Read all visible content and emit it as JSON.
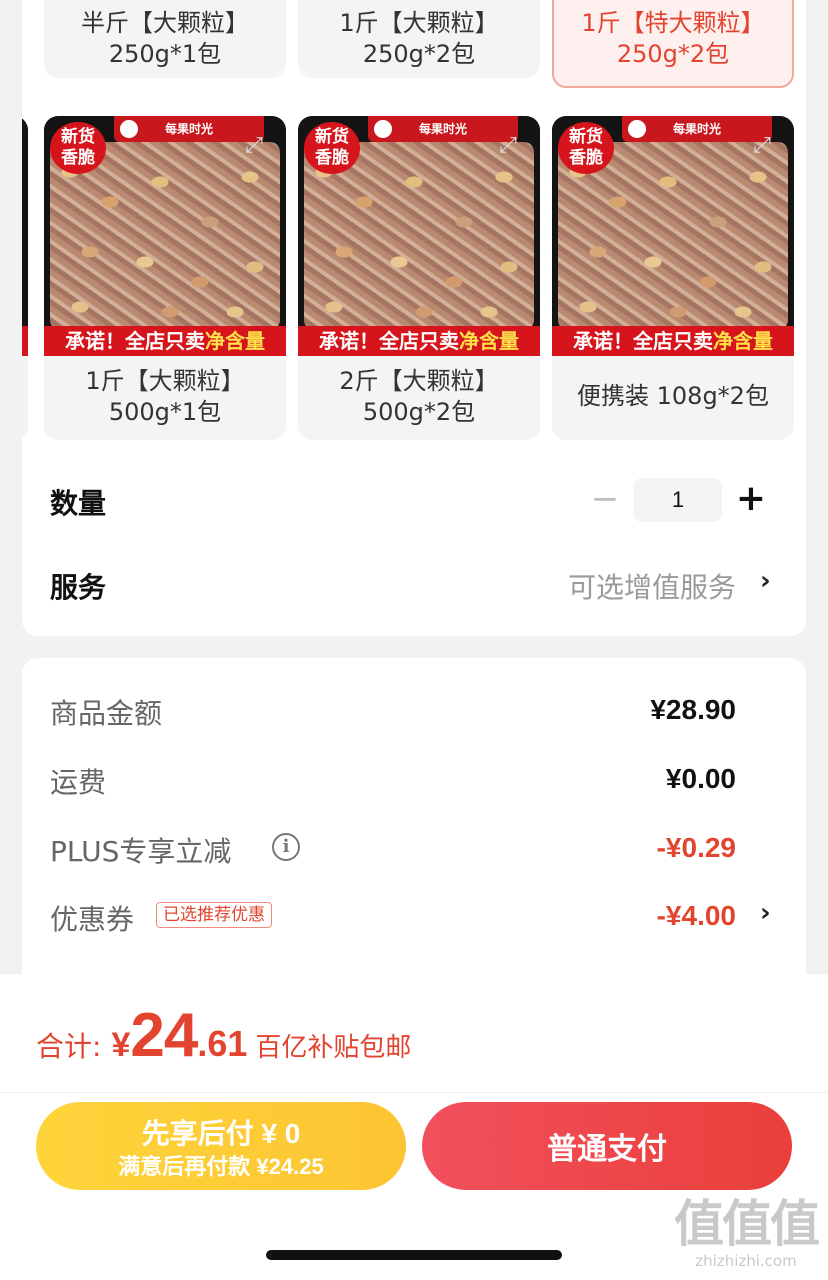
{
  "sku": {
    "top_row": [
      {
        "line1": "半斤【大颗粒】",
        "line2": "250g*1包",
        "selected": false
      },
      {
        "line1": "1斤【大颗粒】",
        "line2": "250g*2包",
        "selected": false
      },
      {
        "line1": "1斤【特大颗粒】",
        "line2": "250g*2包",
        "selected": true
      }
    ],
    "bottom_row": [
      {
        "line1": "1斤【大颗粒】",
        "line2": "500g*1包"
      },
      {
        "line1": "2斤【大颗粒】",
        "line2": "500g*2包"
      },
      {
        "line1": "便携装 108g*2包",
        "line2": ""
      }
    ],
    "image": {
      "brand": "每果时光",
      "tag_line1": "新货",
      "tag_line2": "香脆",
      "banner_main": "承诺！全店只卖",
      "banner_highlight": "净含量"
    }
  },
  "quantity": {
    "label": "数量",
    "value": "1",
    "minus": "−",
    "plus": "+"
  },
  "service": {
    "label": "服务",
    "hint": "可选增值服务"
  },
  "price": {
    "goods_label": "商品金额",
    "goods_value": "¥28.90",
    "shipping_label": "运费",
    "shipping_value": "¥0.00",
    "plus_label": "PLUS专享立减",
    "plus_value": "-¥0.29",
    "coupon_label": "优惠券",
    "coupon_badge": "已选推荐优惠",
    "coupon_value": "-¥4.00"
  },
  "total": {
    "label": "合计:",
    "currency": "¥",
    "integer": "24",
    "decimal": ".61",
    "note": "百亿补贴包邮"
  },
  "actions": {
    "pay_later_line1": "先享后付 ¥ 0",
    "pay_later_line2": "满意后再付款 ¥24.25",
    "pay_now": "普通支付"
  },
  "watermark": {
    "text": "值值值",
    "url": "zhizhizhi.com"
  },
  "colors": {
    "accent": "#e2442f",
    "pay_later": "#fbc531",
    "pay_now": "#ea3f3a"
  }
}
